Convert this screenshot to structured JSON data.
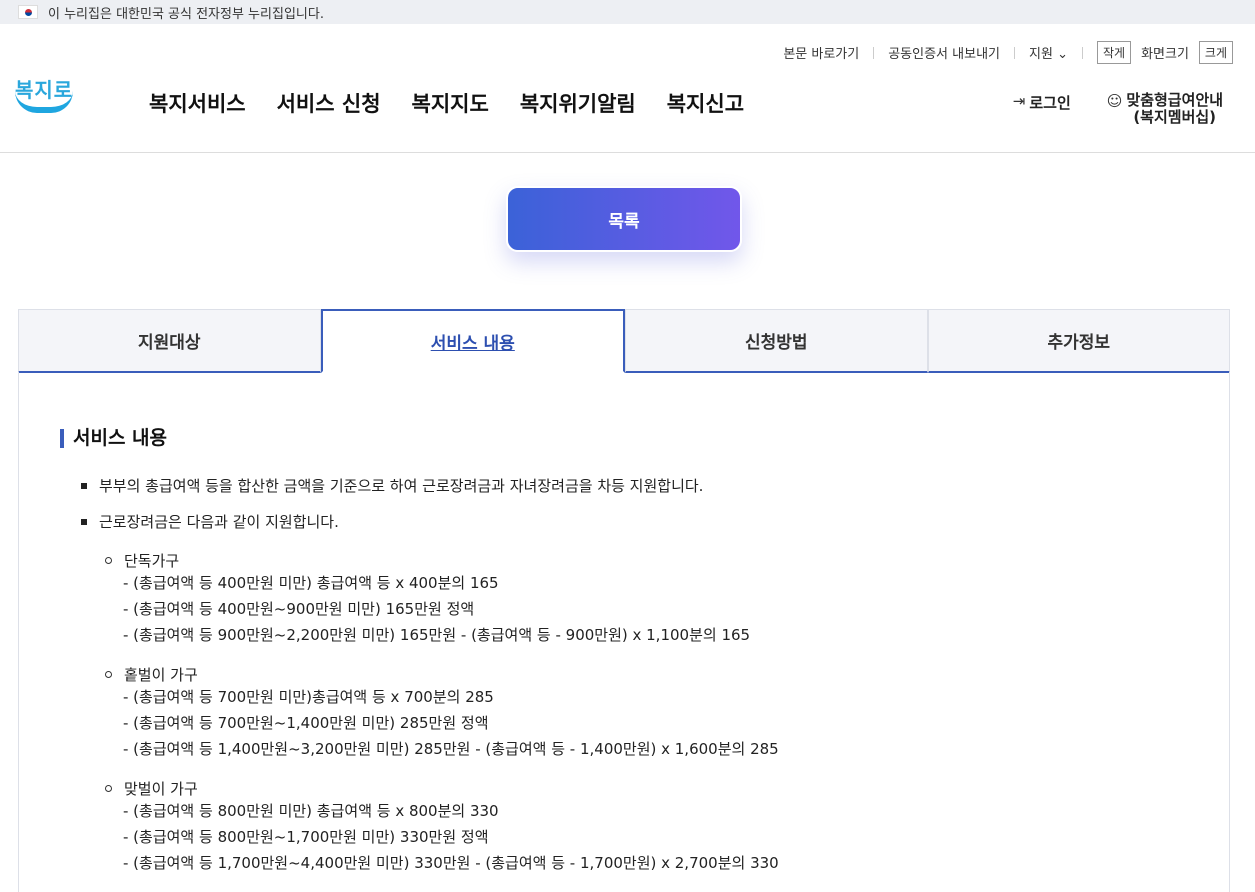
{
  "banner": {
    "text": "이 누리집은 대한민국 공식 전자정부 누리집입니다."
  },
  "util": {
    "skip": "본문 바로가기",
    "cert": "공동인증서 내보내기",
    "support": "지원",
    "small": "작게",
    "screen": "화면크기",
    "large": "크게"
  },
  "logo": {
    "text": "복지로"
  },
  "gnb": [
    "복지서비스",
    "서비스 신청",
    "복지지도",
    "복지위기알림",
    "복지신고"
  ],
  "account": {
    "login": "로그인",
    "member_line1": "맞춤형급여안내",
    "member_line2": "(복지멤버십)"
  },
  "list_button": "목록",
  "tabs": [
    "지원대상",
    "서비스 내용",
    "신청방법",
    "추가정보"
  ],
  "section_title": "서비스 내용",
  "bullets": [
    "부부의 총급여액 등을 합산한 금액을 기준으로 하여 근로장려금과 자녀장려금을 차등 지원합니다.",
    "근로장려금은 다음과 같이 지원합니다."
  ],
  "groups": [
    {
      "title": "단독가구",
      "lines": [
        "- (총급여액 등 400만원 미만) 총급여액 등 x 400분의 165",
        "- (총급여액 등 400만원~900만원 미만) 165만원 정액",
        "- (총급여액 등 900만원~2,200만원 미만) 165만원 - (총급여액 등 - 900만원) x 1,100분의 165"
      ]
    },
    {
      "title": "홑벌이 가구",
      "lines": [
        "- (총급여액 등 700만원 미만)총급여액 등 x 700분의 285",
        "- (총급여액 등 700만원~1,400만원 미만) 285만원 정액",
        "- (총급여액 등 1,400만원~3,200만원 미만) 285만원 - (총급여액 등 - 1,400만원) x 1,600분의 285"
      ]
    },
    {
      "title": "맞벌이 가구",
      "lines": [
        "- (총급여액 등 800만원 미만) 총급여액 등 x 800분의 330",
        "- (총급여액 등 800만원~1,700만원 미만) 330만원 정액",
        "- (총급여액 등 1,700만원~4,400만원 미만) 330만원 - (총급여액 등 - 1,700만원) x 2,700분의 330"
      ]
    }
  ]
}
